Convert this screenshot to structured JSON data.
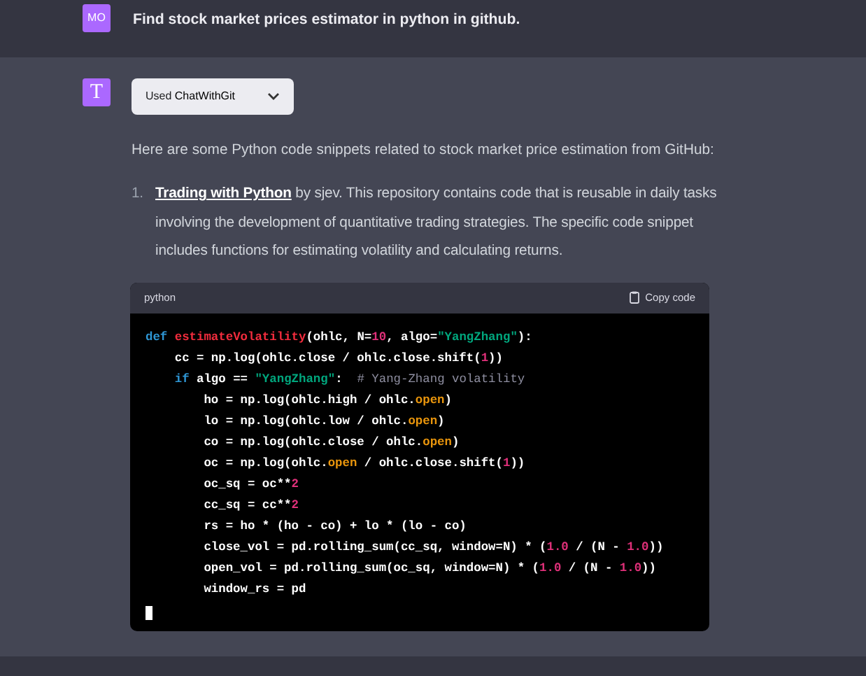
{
  "user_message": {
    "avatar": "MO",
    "text": "Find stock market prices estimator in python in github."
  },
  "assistant": {
    "avatar": "T",
    "plugin": {
      "prefix": "Used",
      "name": "ChatWithGit",
      "expanded": false
    },
    "intro": "Here are some Python code snippets related to stock market price estimation from GitHub:",
    "items": [
      {
        "number": "1.",
        "link": "Trading with Python",
        "text": " by sjev. This repository contains code that is reusable in daily tasks involving the development of quantitative trading strategies. The specific code snippet includes functions for estimating volatility and calculating returns."
      }
    ],
    "code_block": {
      "language": "python",
      "copy_label": "Copy code",
      "cursor": true,
      "lines": [
        [
          {
            "kind": "keyword",
            "text": "def "
          },
          {
            "kind": "function",
            "text": "estimateVolatility"
          },
          {
            "kind": "plain",
            "text": "(ohlc, N="
          },
          {
            "kind": "number",
            "text": "10"
          },
          {
            "kind": "plain",
            "text": ", algo="
          },
          {
            "kind": "string",
            "text": "\"YangZhang\""
          },
          {
            "kind": "plain",
            "text": "):"
          }
        ],
        [
          {
            "kind": "plain",
            "text": "    cc = np.log(ohlc.close / ohlc.close.shift("
          },
          {
            "kind": "number",
            "text": "1"
          },
          {
            "kind": "plain",
            "text": "))"
          }
        ],
        [
          {
            "kind": "keyword",
            "text": "    if "
          },
          {
            "kind": "plain",
            "text": "algo == "
          },
          {
            "kind": "string",
            "text": "\"YangZhang\""
          },
          {
            "kind": "plain",
            "text": ":  "
          },
          {
            "kind": "comment",
            "text": "# Yang-Zhang volatility"
          }
        ],
        [
          {
            "kind": "plain",
            "text": "        ho = np.log(ohlc.high / ohlc."
          },
          {
            "kind": "builtin",
            "text": "open"
          },
          {
            "kind": "plain",
            "text": ")"
          }
        ],
        [
          {
            "kind": "plain",
            "text": "        lo = np.log(ohlc.low / ohlc."
          },
          {
            "kind": "builtin",
            "text": "open"
          },
          {
            "kind": "plain",
            "text": ")"
          }
        ],
        [
          {
            "kind": "plain",
            "text": "        co = np.log(ohlc.close / ohlc."
          },
          {
            "kind": "builtin",
            "text": "open"
          },
          {
            "kind": "plain",
            "text": ")"
          }
        ],
        [
          {
            "kind": "plain",
            "text": "        oc = np.log(ohlc."
          },
          {
            "kind": "builtin",
            "text": "open"
          },
          {
            "kind": "plain",
            "text": " / ohlc.close.shift("
          },
          {
            "kind": "number",
            "text": "1"
          },
          {
            "kind": "plain",
            "text": "))"
          }
        ],
        [
          {
            "kind": "plain",
            "text": "        oc_sq = oc**"
          },
          {
            "kind": "number",
            "text": "2"
          }
        ],
        [
          {
            "kind": "plain",
            "text": "        cc_sq = cc**"
          },
          {
            "kind": "number",
            "text": "2"
          }
        ],
        [
          {
            "kind": "plain",
            "text": "        rs = ho * (ho - co) + lo * (lo - co)"
          }
        ],
        [
          {
            "kind": "plain",
            "text": "        close_vol = pd.rolling_sum(cc_sq, window=N) * ("
          },
          {
            "kind": "number",
            "text": "1.0"
          },
          {
            "kind": "plain",
            "text": " / (N - "
          },
          {
            "kind": "number",
            "text": "1.0"
          },
          {
            "kind": "plain",
            "text": "))"
          }
        ],
        [
          {
            "kind": "plain",
            "text": "        open_vol = pd.rolling_sum(oc_sq, window=N) * ("
          },
          {
            "kind": "number",
            "text": "1.0"
          },
          {
            "kind": "plain",
            "text": " / (N - "
          },
          {
            "kind": "number",
            "text": "1.0"
          },
          {
            "kind": "plain",
            "text": "))"
          }
        ],
        [
          {
            "kind": "plain",
            "text": "        window_rs = pd"
          }
        ]
      ]
    }
  }
}
